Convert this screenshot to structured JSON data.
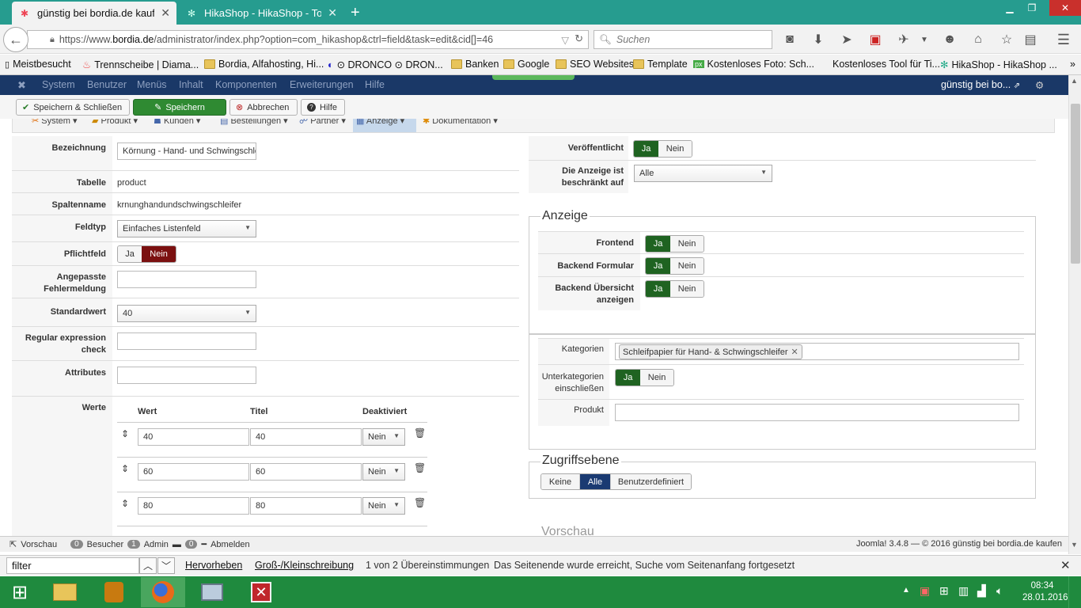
{
  "browser": {
    "tabs": [
      {
        "title": "günstig bei bordia.de kauf...",
        "icon": "joomla-icon"
      },
      {
        "title": "HikaShop - HikaShop - To...",
        "icon": "hikashop-icon"
      }
    ],
    "url_prefix": "https://www.",
    "url_domain": "bordia.de",
    "url_rest": "/administrator/index.php?option=com_hikashop&ctrl=field&task=edit&cid[]=46",
    "search_placeholder": "Suchen",
    "bookmarks": [
      "Meistbesucht",
      "Trennscheibe | Diama...",
      "Bordia, Alfahosting, Hi...",
      "⊙ DRONCO ⊙ DRON...",
      "Banken",
      "Google",
      "SEO Websites",
      "Template",
      "Kostenloses Foto: Sch...",
      "Kostenloses Tool für Ti...",
      "HikaShop - HikaShop ..."
    ]
  },
  "joomla_menu": [
    "System",
    "Benutzer",
    "Menüs",
    "Inhalt",
    "Komponenten",
    "Erweiterungen",
    "Hilfe"
  ],
  "site_link": "günstig bei bo...",
  "toolbar": {
    "save_close": "Speichern & Schließen",
    "save": "Speichern",
    "cancel": "Abbrechen",
    "help": "Hilfe"
  },
  "submenu": [
    "System ▾",
    "Produkt ▾",
    "Kunden ▾",
    "Bestellungen ▾",
    "Partner ▾",
    "Anzeige ▾",
    "Dokumentation ▾"
  ],
  "form": {
    "bezeichnung_label": "Bezeichnung",
    "bezeichnung_value": "Körnung - Hand- und Schwingschleifer",
    "tabelle_label": "Tabelle",
    "tabelle_value": "product",
    "spaltenname_label": "Spaltenname",
    "spaltenname_value": "krnunghandundschwingschleifer",
    "feldtyp_label": "Feldtyp",
    "feldtyp_value": "Einfaches Listenfeld",
    "pflichtfeld_label": "Pflichtfeld",
    "fehlermeldung_label1": "Angepasste",
    "fehlermeldung_label2": "Fehlermeldung",
    "standardwert_label": "Standardwert",
    "standardwert_value": "40",
    "regex_label1": "Regular expression",
    "regex_label2": "check",
    "attributes_label": "Attributes",
    "werte_label": "Werte",
    "werte_headers": {
      "wert": "Wert",
      "titel": "Titel",
      "deaktiviert": "Deaktiviert"
    },
    "werte_rows": [
      {
        "wert": "40",
        "titel": "40",
        "deaktiviert": "Nein"
      },
      {
        "wert": "60",
        "titel": "60",
        "deaktiviert": "Nein"
      },
      {
        "wert": "80",
        "titel": "80",
        "deaktiviert": "Nein"
      }
    ],
    "yes": "Ja",
    "no": "Nein"
  },
  "right": {
    "veroeffentlicht": "Veröffentlicht",
    "anzeige_beschraenkt1": "Die Anzeige ist",
    "anzeige_beschraenkt2": "beschränkt auf",
    "anzeige_beschraenkt_value": "Alle",
    "anzeige_legend": "Anzeige",
    "frontend": "Frontend",
    "backend_formular": "Backend Formular",
    "backend_uebersicht1": "Backend Übersicht",
    "backend_uebersicht2": "anzeigen",
    "kategorien": "Kategorien",
    "kategorie_tag": "Schleifpapier für Hand- & Schwingschleifer",
    "unterkategorien1": "Unterkategorien",
    "unterkategorien2": "einschließen",
    "produkt": "Produkt",
    "zugriff_legend": "Zugriffsebene",
    "zugriff_options": [
      "Keine",
      "Alle",
      "Benutzerdefiniert"
    ],
    "vorschau": "Vorschau"
  },
  "status": {
    "vorschau": "Vorschau",
    "besucher_count": "0",
    "besucher": "Besucher",
    "admin_count": "1",
    "admin": "Admin",
    "msg_count": "0",
    "abmelden": "Abmelden",
    "copyright": "Joomla! 3.4.8  —  © 2016 günstig bei bordia.de kaufen"
  },
  "findbar": {
    "query": "filter",
    "highlight": "Hervorheben",
    "case": "Groß-/Kleinschreibung",
    "matches": "1 von 2 Übereinstimmungen",
    "message": "Das Seitenende wurde erreicht, Suche vom Seitenanfang fortgesetzt"
  },
  "taskbar": {
    "time": "08:34",
    "date": "28.01.2016"
  },
  "colors": {
    "tabbar": "#269c8f",
    "joomla_header": "#1a3867",
    "btn_green": "#2f8a32",
    "yes_active": "#1f6321",
    "no_active": "#7b1010",
    "taskbar": "#1f8a3e"
  }
}
